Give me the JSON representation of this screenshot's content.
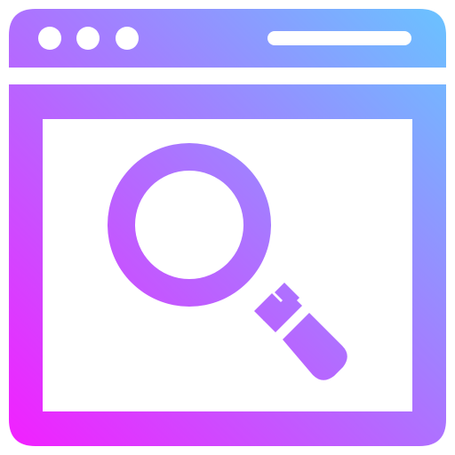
{
  "icon": {
    "name": "browser-search-icon",
    "gradient": {
      "start_color": "#F51CFF",
      "end_color": "#67C6FF"
    },
    "window": {
      "title_bar_buttons": 3
    }
  }
}
